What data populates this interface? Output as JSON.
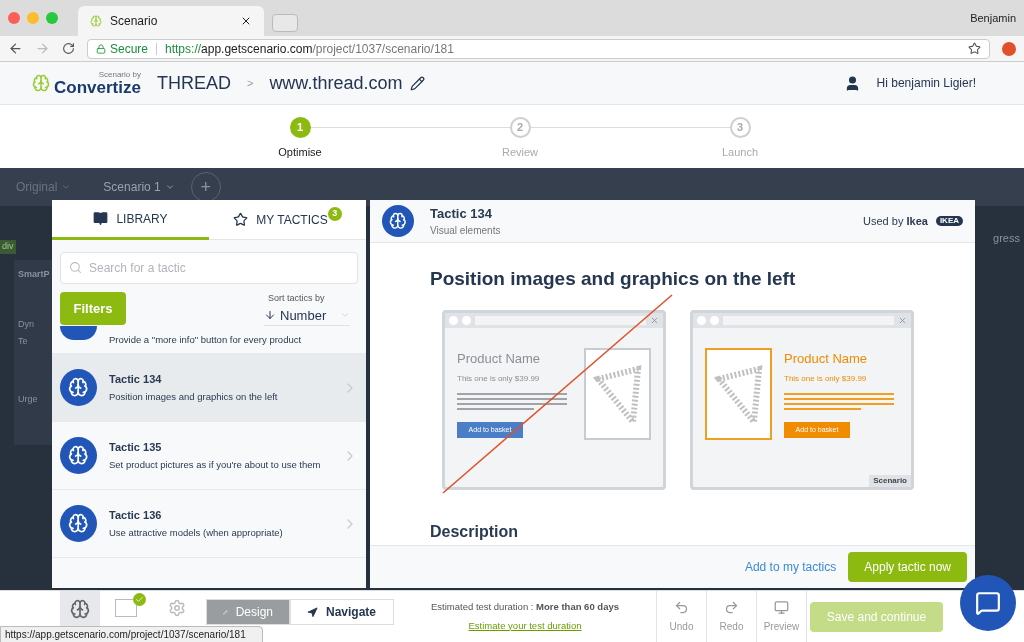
{
  "browser": {
    "tab_title": "Scenario",
    "user": "Benjamin",
    "secure_label": "Secure",
    "url_scheme": "https://",
    "url_host": "app.getscenario.com",
    "url_path": "/project/1037/scenario/181"
  },
  "header": {
    "logo_small": "Scenario by",
    "logo": "Convertize",
    "project": "THREAD",
    "separator": ">",
    "site": "www.thread.com",
    "greeting": "Hi benjamin Ligier!"
  },
  "steps": [
    {
      "number": "1",
      "label": "Optimise",
      "selected": true
    },
    {
      "number": "2",
      "label": "Review",
      "selected": false
    },
    {
      "number": "3",
      "label": "Launch",
      "selected": false
    }
  ],
  "background": {
    "versions": [
      "Original",
      "Scenario 1"
    ],
    "add": "+",
    "tag": "div",
    "panel_title": "SmartP",
    "items": [
      "Dyn",
      "Te",
      "Urge"
    ],
    "right_text": "gress"
  },
  "library": {
    "tabs": [
      {
        "label": "LIBRARY",
        "selected": true
      },
      {
        "label": "MY TACTICS",
        "selected": false,
        "badge": "3"
      }
    ],
    "search": {
      "placeholder": "Search for a tactic"
    },
    "filters": "Filters",
    "sort_label": "Sort tactics by",
    "sort_value": "Number",
    "tactics": [
      {
        "description": "Provide a \"more info\" button for every product",
        "selected": false
      },
      {
        "title": "Tactic 134",
        "description": "Position images and graphics on the left",
        "selected": true
      },
      {
        "title": "Tactic 135",
        "description": "Set product pictures as if you're about to use them",
        "selected": false
      },
      {
        "title": "Tactic 136",
        "description": "Use attractive models (when appropriate)",
        "selected": false
      }
    ]
  },
  "detail": {
    "title": "Tactic 134",
    "category": "Visual elements",
    "used_by": "Used by",
    "brand": "Ikea",
    "brand_logo": "IKEA",
    "heading": "Position images and graphics on the left",
    "examples": [
      {
        "kind": "bad",
        "product": "Product Name",
        "price": "This one is only $39.99",
        "button": "Add to basket"
      },
      {
        "kind": "good",
        "product": "Product Name",
        "price": "This one is only $39.99",
        "button": "Add to basket",
        "credit": "Scenario"
      }
    ],
    "section": "Description",
    "add_link": "Add to my tactics",
    "apply": "Apply tactic now"
  },
  "toolbar": {
    "ab_checked": true,
    "modes": [
      {
        "label": "Design",
        "selected": true
      },
      {
        "label": "Navigate",
        "selected": false
      }
    ],
    "duration": "Estimated test duration : **More than 60 days**",
    "duration_link": "Estimate your test duration",
    "actions": [
      {
        "kind": "undo",
        "label": "Undo"
      },
      {
        "kind": "redo",
        "label": "Redo"
      },
      {
        "kind": "preview",
        "label": "Preview"
      }
    ],
    "save": {
      "label": "Save and continue",
      "disabled": true
    }
  },
  "status_url": "https://app.getscenario.com/project/1037/scenario/181"
}
